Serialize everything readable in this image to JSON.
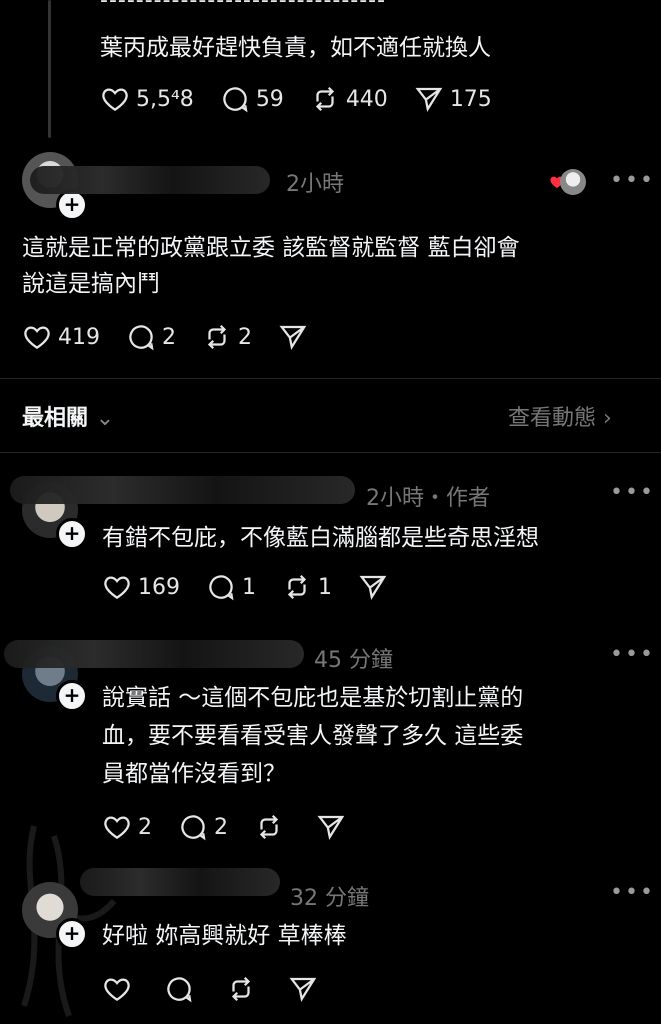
{
  "top_post": {
    "dashes": "--------------------------------",
    "text": "葉丙成最好趕快負責，如不適任就換人",
    "likes": "5,5⁴8",
    "replies": "59",
    "reposts": "440",
    "shares": "175"
  },
  "reply1": {
    "username": "j...............15",
    "time": "2小時",
    "line1": "這就是正常的政黨跟立委 該監督就監督 藍白卻會",
    "line2": "說這是搞內鬥",
    "likes": "419",
    "replies": "2",
    "reposts": "2"
  },
  "sort_bar": {
    "label": "最相關",
    "view_activity": "查看動態"
  },
  "comments": [
    {
      "username": "............",
      "time": "2小時・作者",
      "lines": [
        "有錯不包庇，不像藍白滿腦都是些奇思淫想"
      ],
      "likes": "169",
      "replies": "1",
      "reposts": "1"
    },
    {
      "username": "............",
      "time": "45 分鐘",
      "lines": [
        "說實話 ～這個不包庇也是基於切割止黨的",
        "血，要不要看看受害人發聲了多久 這些委",
        "員都當作沒看到？"
      ],
      "likes": "2",
      "replies": "2",
      "reposts": ""
    },
    {
      "username": "............15",
      "time": "32 分鐘",
      "lines": [
        "好啦 妳高興就好 草棒棒"
      ],
      "likes": "",
      "replies": "",
      "reposts": ""
    }
  ],
  "colors": {
    "background": "#000000",
    "text": "#f3f5f7",
    "muted": "#77777a",
    "heart": "#ff3040"
  }
}
